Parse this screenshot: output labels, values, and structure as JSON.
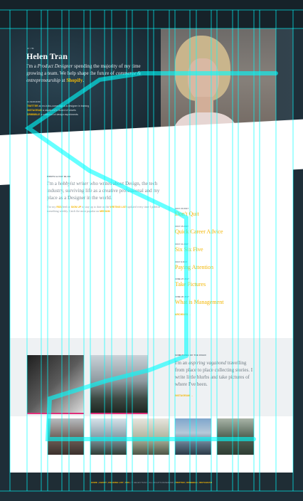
{
  "hero": {
    "kicker": "HI I'M",
    "name": "Helen Tran",
    "bio_prefix": "I'm a ",
    "bio_role": "Product Designer",
    "bio_middle": " spending the majority of my time growing a team. We help shape the future of ",
    "bio_topic": "commerce & entrepreneurship",
    "bio_at": " at ",
    "bio_company": "Shopify",
    "bio_end": ".",
    "elsewhere_label": "ELSEWHERE",
    "social": [
      {
        "name": "TWITTER",
        "text": "an ex-hobo-comedian & a designer in training"
      },
      {
        "name": "INSTAGRAM",
        "text": "a vagabond's record of travels"
      },
      {
        "name": "DRIBBBLE",
        "text": "a collection of design experiments"
      }
    ]
  },
  "about": {
    "label": "MONTH & DAY BLOG",
    "p1_prefix": "I'm a ",
    "p1_italic": "hobbyist writer",
    "p1_rest": " who writes about Design, the tech industry, surviving life as a creative professional and my place as a Designer in the world.",
    "p2_prefix": "Use my ",
    "p2_link1": "RSS",
    "p2_mid1": " feed or ",
    "p2_link2": "SIGN UP",
    "p2_mid2": " to stay up to date on the ",
    "p2_link3": "WRITING LIST",
    "p2_rest": " updated every time I publish something weekly. Catch the most popular on ",
    "p2_link4": "MEDIUM",
    "p2_end": "."
  },
  "posts": [
    {
      "date": "JULY 20 2017",
      "title": "Don't Quit"
    },
    {
      "date": "JULY 15 2017",
      "title": "Quick Career Advice"
    },
    {
      "date": "JULY 11 2017",
      "title": "Six Six Five"
    },
    {
      "date": "JULY 8 2017",
      "title": "Paying Attention"
    },
    {
      "date": "JUNE 27 2017",
      "title": "Take Pictures"
    },
    {
      "date": "JUNE 20 2017",
      "title": "What is Management"
    }
  ],
  "archives_label": "ARCHIVES →",
  "travel": {
    "label": "SOMETHING OF THE ROAD",
    "prefix": "I'm an ",
    "italic": "aspiring vagabond",
    "rest": " travelling from place to place collecting stories. I write little blurbs and take pictures of where I've been.",
    "instagram_label": "INSTAGRAM →"
  },
  "photos": [
    "photo-dancer",
    "photo-mountains",
    "photo-street",
    "photo-snow-peak",
    "photo-field",
    "photo-lake",
    "photo-forest"
  ],
  "footer": {
    "nav": [
      "HOME",
      "ABOUT",
      "READING LIST",
      "RSS"
    ],
    "copyright": "© HELEN TRAN · ALL RIGHTS RESERVED",
    "social": [
      "TWITTER",
      "DRIBBBLE",
      "INSTAGRAM"
    ]
  },
  "colors": {
    "accent": "#f2b705",
    "dark": "#1e2e38",
    "overlay_lines": "#00ffff",
    "photo_border": "#e02f7a"
  }
}
